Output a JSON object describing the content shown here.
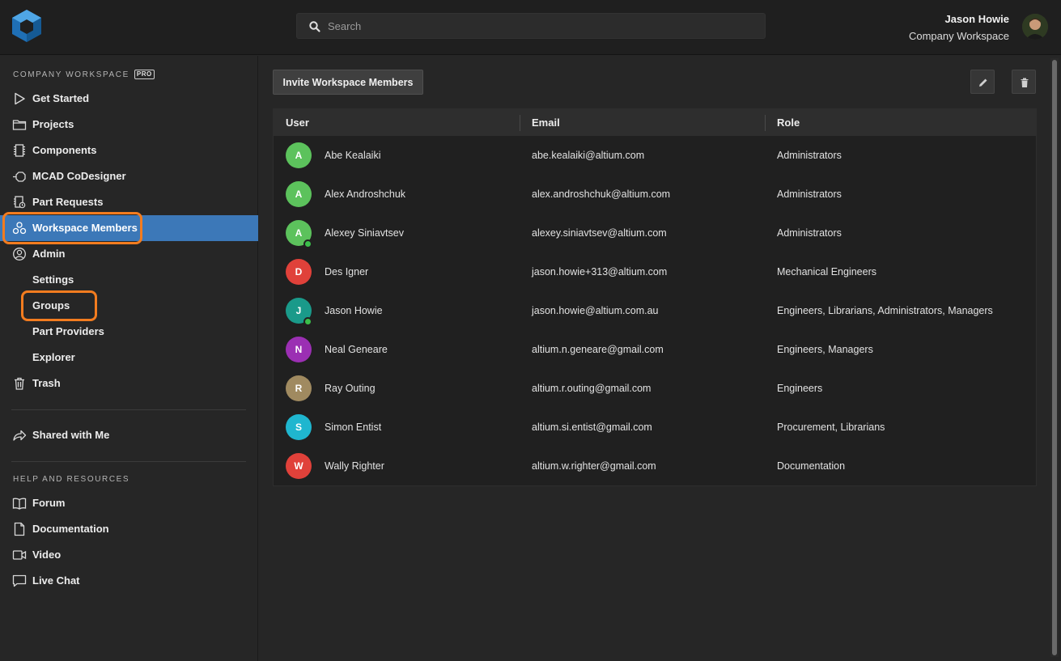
{
  "header": {
    "search_placeholder": "Search",
    "user_name": "Jason Howie",
    "workspace_name": "Company Workspace"
  },
  "sidebar": {
    "workspace_label": "COMPANY WORKSPACE",
    "pro_badge": "PRO",
    "items": [
      {
        "label": "Get Started",
        "icon": "play-icon"
      },
      {
        "label": "Projects",
        "icon": "folder-icon"
      },
      {
        "label": "Components",
        "icon": "chip-icon"
      },
      {
        "label": "MCAD CoDesigner",
        "icon": "cube-link-icon"
      },
      {
        "label": "Part Requests",
        "icon": "part-request-icon"
      },
      {
        "label": "Workspace Members",
        "icon": "members-icon",
        "active": true
      },
      {
        "label": "Admin",
        "icon": "user-circle-icon"
      }
    ],
    "admin_sub": [
      {
        "label": "Settings"
      },
      {
        "label": "Groups"
      },
      {
        "label": "Part Providers"
      },
      {
        "label": "Explorer"
      }
    ],
    "trash_label": "Trash",
    "shared_label": "Shared with Me",
    "help_label": "HELP AND RESOURCES",
    "help_items": [
      {
        "label": "Forum",
        "icon": "book-icon"
      },
      {
        "label": "Documentation",
        "icon": "document-icon"
      },
      {
        "label": "Video",
        "icon": "video-icon"
      },
      {
        "label": "Live Chat",
        "icon": "chat-icon"
      }
    ],
    "active_color": "#3c78b8",
    "highlight_color": "#f37c1f"
  },
  "main": {
    "invite_label": "Invite Workspace Members",
    "columns": {
      "user": "User",
      "email": "Email",
      "role": "Role"
    },
    "members": [
      {
        "initial": "A",
        "name": "Abe Kealaiki",
        "email": "abe.kealaiki@altium.com",
        "role": "Administrators",
        "color": "#5cc25c",
        "online": false
      },
      {
        "initial": "A",
        "name": "Alex Androshchuk",
        "email": "alex.androshchuk@altium.com",
        "role": "Administrators",
        "color": "#5cc25c",
        "online": false
      },
      {
        "initial": "A",
        "name": "Alexey Siniavtsev",
        "email": "alexey.siniavtsev@altium.com",
        "role": "Administrators",
        "color": "#5cc25c",
        "online": true
      },
      {
        "initial": "D",
        "name": "Des Igner",
        "email": "jason.howie+313@altium.com",
        "role": "Mechanical Engineers",
        "color": "#e0413a",
        "online": false
      },
      {
        "initial": "J",
        "name": "Jason Howie",
        "email": "jason.howie@altium.com.au",
        "role": "Engineers, Librarians, Administrators, Managers",
        "color": "#1a9a8a",
        "online": true
      },
      {
        "initial": "N",
        "name": "Neal Geneare",
        "email": "altium.n.geneare@gmail.com",
        "role": "Engineers, Managers",
        "color": "#9b2fb3",
        "online": false
      },
      {
        "initial": "R",
        "name": "Ray Outing",
        "email": "altium.r.outing@gmail.com",
        "role": "Engineers",
        "color": "#a08a60",
        "online": false
      },
      {
        "initial": "S",
        "name": "Simon Entist",
        "email": "altium.si.entist@gmail.com",
        "role": "Procurement, Librarians",
        "color": "#1fb6cf",
        "online": false
      },
      {
        "initial": "W",
        "name": "Wally Righter",
        "email": "altium.w.righter@gmail.com",
        "role": "Documentation",
        "color": "#e0413a",
        "online": false
      }
    ]
  }
}
